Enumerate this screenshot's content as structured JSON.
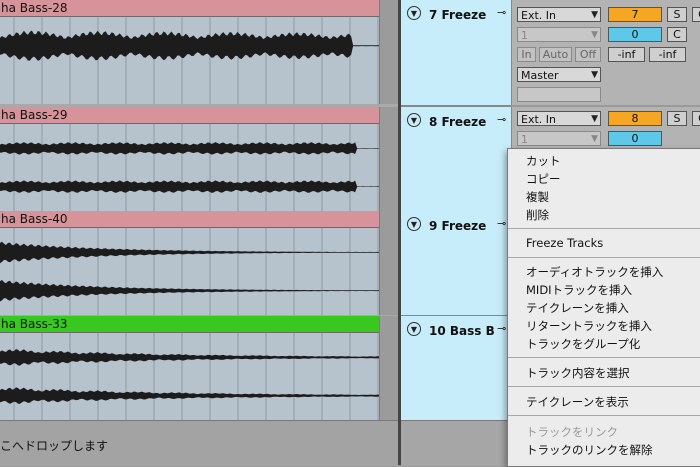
{
  "clips": [
    {
      "name": "ha Bass-28",
      "color": "#d7939a"
    },
    {
      "name": "ha Bass-29",
      "color": "#d7939a"
    },
    {
      "name": "ha Bass-40",
      "color": "#d7939a"
    },
    {
      "name": "ha Bass-33",
      "color": "#39c81f"
    }
  ],
  "tracks": [
    {
      "name": "7 Freeze",
      "input": "Ext. In",
      "channel": "1",
      "monitor": [
        "In",
        "Auto",
        "Off"
      ],
      "output": "Master",
      "number": "7",
      "volume": "0",
      "solo": "S",
      "extra": "C",
      "peak_left": "-inf",
      "peak_right": "-inf"
    },
    {
      "name": "8 Freeze",
      "input": "Ext. In",
      "channel": "1",
      "number": "8",
      "volume": "0",
      "solo": "S",
      "extra": "C"
    },
    {
      "name": "9 Freeze"
    },
    {
      "name": "10 Bass B"
    }
  ],
  "drop_hint": "こへドロップします",
  "menu": {
    "group1": [
      "カット",
      "コピー",
      "複製",
      "削除"
    ],
    "group2": [
      "Freeze Tracks"
    ],
    "group3": [
      "オーディオトラックを挿入",
      "MIDIトラックを挿入",
      "テイクレーンを挿入",
      "リターントラックを挿入",
      "トラックをグループ化"
    ],
    "group4": [
      "トラック内容を選択"
    ],
    "group5": [
      "テイクレーンを表示"
    ],
    "group6_disabled": "トラックをリンク",
    "group6": [
      "トラックのリンクを解除"
    ]
  }
}
